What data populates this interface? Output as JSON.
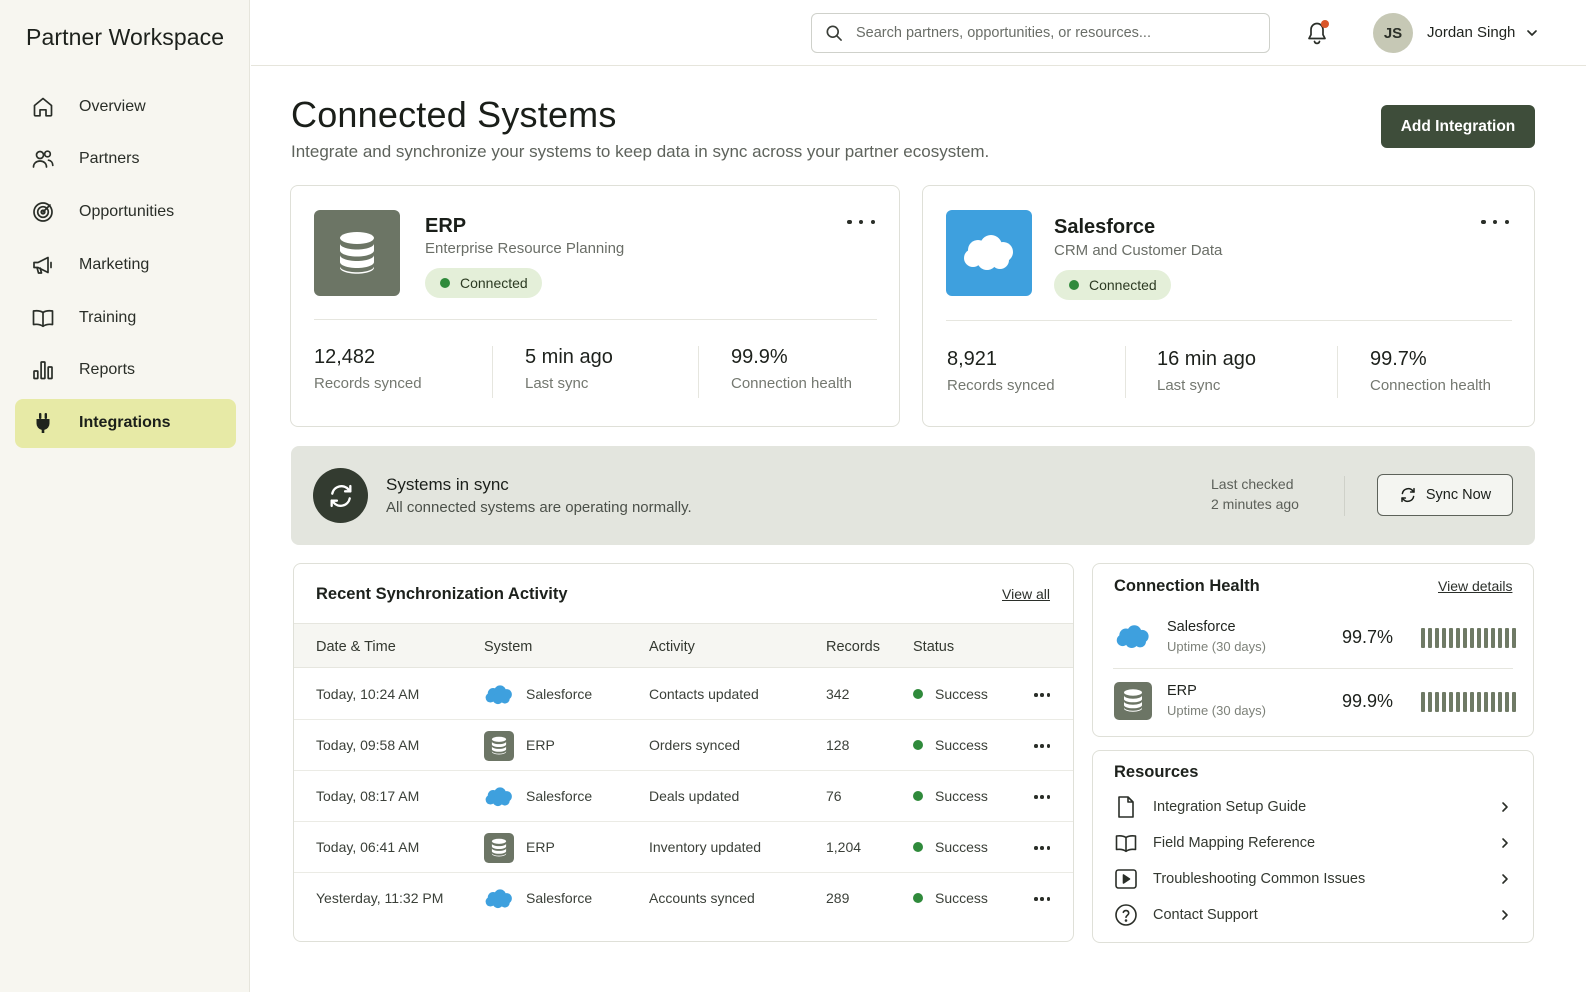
{
  "sidebar": {
    "brand": "Partner Workspace",
    "items": [
      {
        "label": "Overview",
        "icon": "home-icon"
      },
      {
        "label": "Partners",
        "icon": "users-icon"
      },
      {
        "label": "Opportunities",
        "icon": "target-icon"
      },
      {
        "label": "Marketing",
        "icon": "megaphone-icon"
      },
      {
        "label": "Training",
        "icon": "book-icon"
      },
      {
        "label": "Reports",
        "icon": "bar-chart-icon"
      },
      {
        "label": "Integrations",
        "icon": "plug-icon",
        "active": true
      }
    ]
  },
  "topbar": {
    "search_placeholder": "Search partners, opportunities, or resources...",
    "user_initials": "JS",
    "user_name": "Jordan Singh"
  },
  "header": {
    "title": "Connected Systems",
    "subtitle": "Integrate and synchronize your systems to keep data in sync across your partner ecosystem.",
    "add_button": "Add Integration"
  },
  "systems": [
    {
      "name": "ERP",
      "description": "Enterprise Resource Planning",
      "status": "Connected",
      "icon": "database-icon",
      "color": "#6c7565",
      "stats": [
        {
          "value": "12,482",
          "label": "Records synced"
        },
        {
          "value": "5 min ago",
          "label": "Last sync"
        },
        {
          "value": "99.9%",
          "label": "Connection health"
        }
      ]
    },
    {
      "name": "Salesforce",
      "description": "CRM and Customer Data",
      "status": "Connected",
      "icon": "cloud-icon",
      "color": "#3ea0de",
      "stats": [
        {
          "value": "8,921",
          "label": "Records synced"
        },
        {
          "value": "16 min ago",
          "label": "Last sync"
        },
        {
          "value": "99.7%",
          "label": "Connection health"
        }
      ]
    }
  ],
  "sync_banner": {
    "title": "Systems in sync",
    "subtitle": "All connected systems are operating normally.",
    "last_checked_label": "Last checked",
    "last_checked_value": "2 minutes ago",
    "button": "Sync Now"
  },
  "activity": {
    "title": "Recent Synchronization Activity",
    "view_all": "View all",
    "columns": [
      "Date & Time",
      "System",
      "Activity",
      "Records",
      "Status"
    ],
    "rows": [
      {
        "time": "Today, 10:24 AM",
        "system": "Salesforce",
        "activity": "Contacts updated",
        "records": "342",
        "status": "Success"
      },
      {
        "time": "Today, 09:58 AM",
        "system": "ERP",
        "activity": "Orders synced",
        "records": "128",
        "status": "Success"
      },
      {
        "time": "Today, 08:17 AM",
        "system": "Salesforce",
        "activity": "Deals updated",
        "records": "76",
        "status": "Success"
      },
      {
        "time": "Today, 06:41 AM",
        "system": "ERP",
        "activity": "Inventory updated",
        "records": "1,204",
        "status": "Success"
      },
      {
        "time": "Yesterday, 11:32 PM",
        "system": "Salesforce",
        "activity": "Accounts synced",
        "records": "289",
        "status": "Success"
      }
    ]
  },
  "health": {
    "title": "Connection Health",
    "view_details": "View details",
    "items": [
      {
        "name": "Salesforce",
        "sub": "Uptime (30 days)",
        "pct": "99.7%",
        "bars": 14
      },
      {
        "name": "ERP",
        "sub": "Uptime (30 days)",
        "pct": "99.9%",
        "bars": 14
      }
    ]
  },
  "resources": {
    "title": "Resources",
    "items": [
      {
        "label": "Integration Setup Guide",
        "icon": "document-icon"
      },
      {
        "label": "Field Mapping Reference",
        "icon": "book-icon"
      },
      {
        "label": "Troubleshooting Common Issues",
        "icon": "play-icon"
      },
      {
        "label": "Contact Support",
        "icon": "help-circle-icon"
      }
    ]
  },
  "colors": {
    "accent": "#3e4d3a",
    "active_nav": "#e7eaa6",
    "success": "#2f8a3b",
    "salesforce": "#3ea0de"
  }
}
